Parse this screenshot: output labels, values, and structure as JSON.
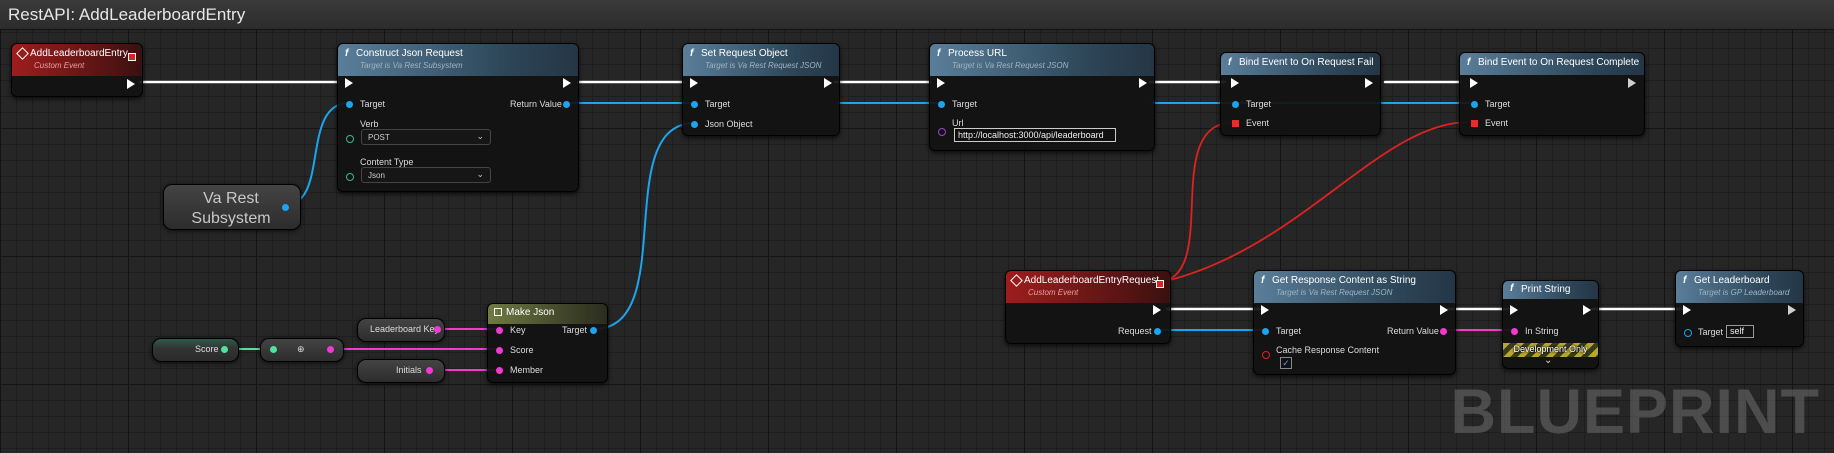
{
  "graph_title": "RestAPI: AddLeaderboardEntry",
  "watermark": "BLUEPRINT",
  "colors": {
    "exec": "#ffffff",
    "object": "#1ca4ee",
    "struct": "#f03ad2",
    "float": "#4fe29c",
    "delegate": "#ee2b2b",
    "function_header": "#5a7e9a",
    "event_header": "#9e1d1d"
  },
  "icons": {
    "function": "function-icon",
    "event": "event-icon",
    "pure": "make-json-icon"
  },
  "nodes": {
    "event_add": {
      "title": "AddLeaderboardEntry",
      "subtitle": "Custom Event"
    },
    "construct": {
      "title": "Construct Json Request",
      "subtitle": "Target is Va Rest Subsystem",
      "target": "Target",
      "return_value": "Return Value",
      "verb_label": "Verb",
      "verb_value": "POST",
      "content_type_label": "Content Type",
      "content_type_value": "Json"
    },
    "subsystem": {
      "label": "Va Rest Subsystem"
    },
    "set_request": {
      "title": "Set Request Object",
      "subtitle": "Target is Va Rest Request JSON",
      "target": "Target",
      "json_object": "Json Object"
    },
    "process_url": {
      "title": "Process URL",
      "subtitle": "Target is Va Rest Request JSON",
      "target": "Target",
      "url_label": "Url",
      "url_value": "http://localhost:3000/api/leaderboard"
    },
    "bind_fail": {
      "title": "Bind Event to On Request Fail",
      "target": "Target",
      "event": "Event"
    },
    "bind_complete": {
      "title": "Bind Event to On Request Complete",
      "target": "Target",
      "event": "Event"
    },
    "event_request": {
      "title": "AddLeaderboardEntryRequest",
      "subtitle": "Custom Event",
      "request": "Request"
    },
    "get_response": {
      "title": "Get Response Content as String",
      "subtitle": "Target is Va Rest Request JSON",
      "target": "Target",
      "return_value": "Return Value",
      "cache_label": "Cache Response Content",
      "cache_checked": true
    },
    "print_string": {
      "title": "Print String",
      "in_string": "In String",
      "dev_only": "Development Only"
    },
    "get_leaderboard": {
      "title": "Get Leaderboard",
      "subtitle": "Target is GP Leaderboard",
      "target": "Target",
      "self_value": "self"
    },
    "make_json": {
      "title": "Make Json",
      "key": "Key",
      "score": "Score",
      "member": "Member",
      "target": "Target"
    },
    "var_key": {
      "label": "Leaderboard Key"
    },
    "var_score": {
      "label": "Score"
    },
    "convert": {
      "label": "⊕"
    },
    "var_initials": {
      "label": "Initials"
    }
  }
}
